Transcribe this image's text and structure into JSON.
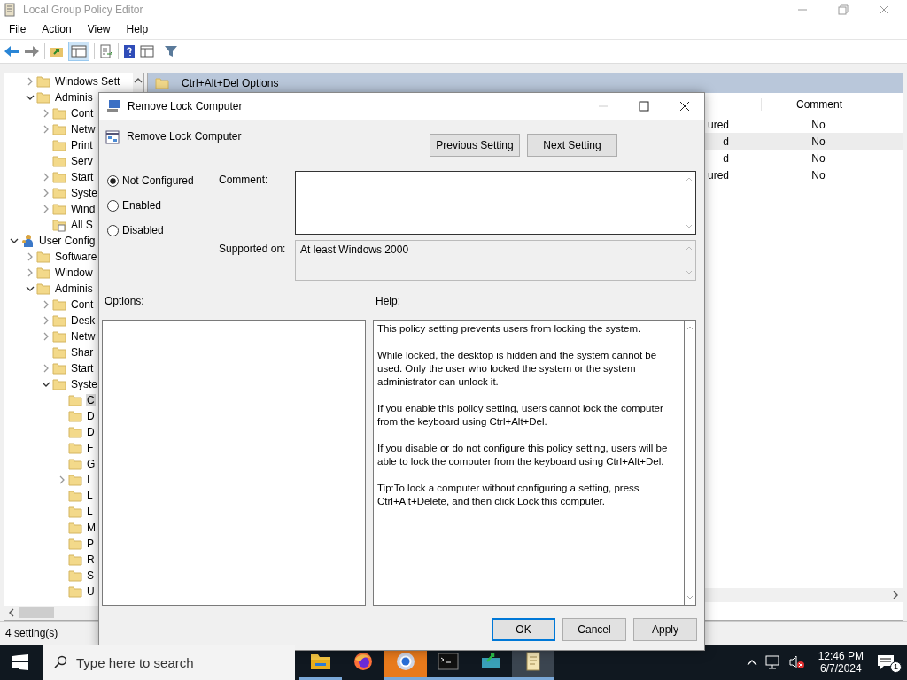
{
  "window": {
    "title": "Local Group Policy Editor"
  },
  "menu": [
    "File",
    "Action",
    "View",
    "Help"
  ],
  "tree": [
    {
      "children": [
        {
          "label": "Windows Sett",
          "expanded": false,
          "kind": "folder",
          "selected": false
        },
        {
          "label": "Adminis",
          "expanded": true,
          "kind": "folder",
          "selected": false,
          "children": [
            {
              "label": "Cont",
              "expanded": false,
              "kind": "folder",
              "selected": false
            },
            {
              "label": "Netw",
              "expanded": false,
              "kind": "folder",
              "selected": false
            },
            {
              "label": "Print",
              "kind": "folder",
              "selected": false
            },
            {
              "label": "Serv",
              "kind": "folder",
              "selected": false
            },
            {
              "label": "Start",
              "expanded": false,
              "kind": "folder",
              "selected": false
            },
            {
              "label": "Syste",
              "expanded": false,
              "kind": "folder",
              "selected": false
            },
            {
              "label": "Wind",
              "expanded": false,
              "kind": "folder",
              "selected": false
            },
            {
              "label": "All S",
              "kind": "settings",
              "selected": false
            }
          ]
        }
      ]
    },
    {
      "label": "User Config",
      "expanded": true,
      "kind": "user",
      "selected": false,
      "children": [
        {
          "label": "Software",
          "expanded": false,
          "kind": "folder",
          "selected": false
        },
        {
          "label": "Window",
          "expanded": false,
          "kind": "folder",
          "selected": false
        },
        {
          "label": "Adminis",
          "expanded": true,
          "kind": "folder",
          "selected": false,
          "children": [
            {
              "label": "Cont",
              "expanded": false,
              "kind": "folder",
              "selected": false
            },
            {
              "label": "Desk",
              "expanded": false,
              "kind": "folder",
              "selected": false
            },
            {
              "label": "Netw",
              "expanded": false,
              "kind": "folder",
              "selected": false
            },
            {
              "label": "Shar",
              "kind": "folder",
              "selected": false
            },
            {
              "label": "Start",
              "expanded": false,
              "kind": "folder",
              "selected": false
            },
            {
              "label": "Syste",
              "expanded": true,
              "kind": "folder",
              "selected": false,
              "children": [
                {
                  "label": "C",
                  "kind": "folder",
                  "selected": true
                },
                {
                  "label": "D",
                  "kind": "folder",
                  "selected": false
                },
                {
                  "label": "D",
                  "kind": "folder",
                  "selected": false
                },
                {
                  "label": "F",
                  "kind": "folder",
                  "selected": false
                },
                {
                  "label": "G",
                  "kind": "folder",
                  "selected": false
                },
                {
                  "label": "I",
                  "expanded": false,
                  "kind": "folder",
                  "selected": false
                },
                {
                  "label": "L",
                  "kind": "folder",
                  "selected": false
                },
                {
                  "label": "L",
                  "kind": "folder",
                  "selected": false
                },
                {
                  "label": "M",
                  "kind": "folder",
                  "selected": false
                },
                {
                  "label": "P",
                  "kind": "folder",
                  "selected": false
                },
                {
                  "label": "R",
                  "kind": "folder",
                  "selected": false
                },
                {
                  "label": "S",
                  "kind": "folder",
                  "selected": false
                },
                {
                  "label": "U",
                  "kind": "folder",
                  "selected": false
                }
              ]
            }
          ]
        }
      ]
    }
  ],
  "right_pane": {
    "heading": "Ctrl+Alt+Del Options",
    "table": {
      "columns": [
        "Comment"
      ],
      "rows": [
        {
          "column_1": "ured",
          "comment": "No",
          "selected": false
        },
        {
          "column_1": "d",
          "comment": "No",
          "selected": true
        },
        {
          "column_1": "d",
          "comment": "No",
          "selected": false
        },
        {
          "column_1": "ured",
          "comment": "No",
          "selected": false
        }
      ]
    }
  },
  "status_bar": "4 setting(s)",
  "dialog": {
    "title": "Remove Lock Computer",
    "setting_name": "Remove Lock Computer",
    "nav_buttons": [
      "Previous Setting",
      "Next Setting"
    ],
    "options": [
      {
        "label": "Not Configured",
        "selected": true
      },
      {
        "label": "Enabled",
        "selected": false
      },
      {
        "label": "Disabled",
        "selected": false
      }
    ],
    "comment_label": "Comment:",
    "supported_label": "Supported on:",
    "supported_value": "At least Windows 2000",
    "options_label": "Options:",
    "help_label": "Help:",
    "help": [
      "This policy setting prevents users from locking the system.",
      "While locked, the desktop is hidden and the system cannot be used. Only the user who locked the system or the system administrator can unlock it.",
      "If you enable this policy setting, users cannot lock the computer from the keyboard using Ctrl+Alt+Del.",
      "If you disable or do not configure this policy setting, users will be able to lock the computer from the keyboard using Ctrl+Alt+Del.",
      "Tip:To lock a computer without configuring a setting, press Ctrl+Alt+Delete, and then click Lock this computer."
    ],
    "buttons": [
      {
        "label": "OK",
        "default": true
      },
      {
        "label": "Cancel",
        "default": false
      },
      {
        "label": "Apply",
        "default": false
      }
    ]
  },
  "taskbar": {
    "search_placeholder": "Type here to search",
    "apps": [
      {
        "kind": "explorer",
        "running": true,
        "attention": false,
        "selected": false
      },
      {
        "kind": "firefox",
        "running": false,
        "attention": false,
        "selected": false
      },
      {
        "kind": "chrome",
        "running": true,
        "attention": true,
        "selected": false
      },
      {
        "kind": "terminal",
        "running": true,
        "attention": false,
        "selected": false
      },
      {
        "kind": "tool",
        "running": true,
        "attention": false,
        "selected": false
      },
      {
        "kind": "notes",
        "running": true,
        "attention": false,
        "selected": true
      }
    ],
    "time": "12:46 PM",
    "date": "6/7/2024",
    "notification_count": "1"
  }
}
